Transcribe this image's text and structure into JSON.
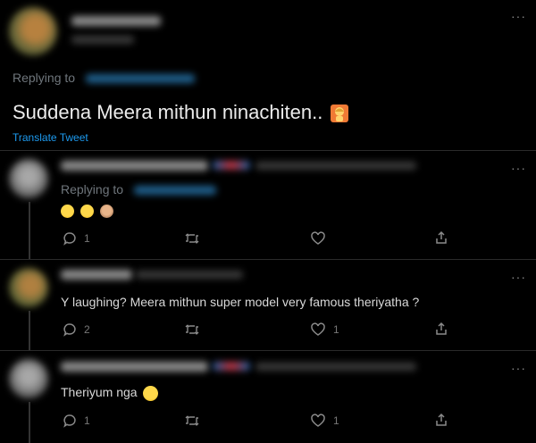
{
  "main_tweet": {
    "replying_label": "Replying to",
    "text": "Suddena Meera mithun ninachiten..",
    "translate_label": "Translate Tweet",
    "more_label": "···"
  },
  "replies": [
    {
      "replying_label": "Replying to",
      "text": "",
      "emojis": [
        "face-with-tears-of-joy",
        "face-with-tears-of-joy",
        "see-no-evil-monkey"
      ],
      "reply_count": "1",
      "retweet_count": "",
      "like_count": "",
      "more_label": "···"
    },
    {
      "text": "Y laughing? Meera mithun  super model very famous theriyatha ?",
      "reply_count": "2",
      "retweet_count": "",
      "like_count": "1",
      "more_label": "···"
    },
    {
      "text": "Theriyum nga",
      "emoji": "smiling-face",
      "reply_count": "1",
      "retweet_count": "",
      "like_count": "1",
      "more_label": "···"
    }
  ],
  "colors": {
    "background": "#000000",
    "link": "#1d9bf0",
    "muted": "#6f767c"
  }
}
